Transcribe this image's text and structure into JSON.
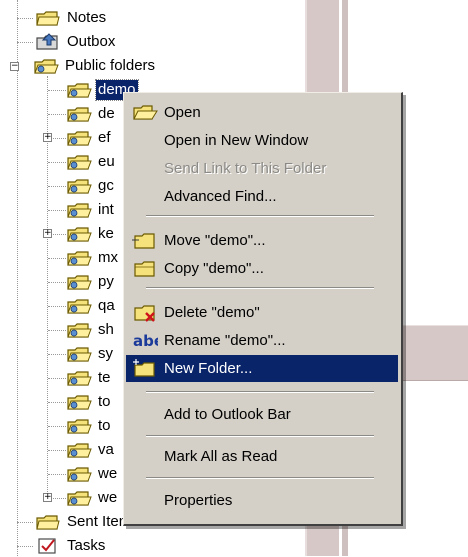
{
  "tree": {
    "top_items": [
      {
        "label": "Notes",
        "icon": "notes-folder-icon"
      },
      {
        "label": "Outbox",
        "icon": "outbox-folder-icon"
      },
      {
        "label": "Public folders",
        "icon": "public-folders-icon",
        "expanded": true
      }
    ],
    "children": [
      {
        "label": "demo",
        "selected": true,
        "expander": ""
      },
      {
        "label": "de",
        "expander": ""
      },
      {
        "label": "ef",
        "expander": "+"
      },
      {
        "label": "eu",
        "expander": ""
      },
      {
        "label": "gc",
        "expander": ""
      },
      {
        "label": "int",
        "expander": ""
      },
      {
        "label": "ke",
        "expander": "+"
      },
      {
        "label": "mx",
        "expander": ""
      },
      {
        "label": "py",
        "expander": ""
      },
      {
        "label": "qa",
        "expander": ""
      },
      {
        "label": "sh",
        "expander": ""
      },
      {
        "label": "sy",
        "expander": ""
      },
      {
        "label": "te",
        "expander": ""
      },
      {
        "label": "to",
        "expander": ""
      },
      {
        "label": "to",
        "expander": ""
      },
      {
        "label": "va",
        "expander": ""
      },
      {
        "label": "we",
        "expander": ""
      },
      {
        "label": "we",
        "expander": "+"
      }
    ],
    "bottom_items": [
      {
        "label": "Sent Items",
        "icon": "sent-items-icon"
      },
      {
        "label": "Tasks",
        "icon": "tasks-icon"
      }
    ]
  },
  "context_menu": {
    "items": [
      {
        "label": "Open",
        "icon": "open-folder-icon"
      },
      {
        "label": "Open in New Window"
      },
      {
        "label": "Send Link to This Folder",
        "disabled": true
      },
      {
        "label": "Advanced Find..."
      },
      {
        "label": "Move \"demo\"...",
        "icon": "move-folder-icon"
      },
      {
        "label": "Copy \"demo\"...",
        "icon": "copy-folder-icon"
      },
      {
        "label": "Delete \"demo\"",
        "icon": "delete-folder-icon"
      },
      {
        "label": "Rename \"demo\"...",
        "icon": "rename-icon"
      },
      {
        "label": "New Folder...",
        "icon": "new-folder-icon",
        "highlighted": true
      },
      {
        "label": "Add to Outlook Bar"
      },
      {
        "label": "Mark All as Read"
      },
      {
        "label": "Properties"
      }
    ]
  },
  "colors": {
    "menu_bg": "#d4d0c8",
    "highlight_bg": "#0a246a",
    "highlight_text": "#ffffff",
    "disabled_text": "#8c8a86",
    "folder_yellow": "#f5e27a"
  }
}
